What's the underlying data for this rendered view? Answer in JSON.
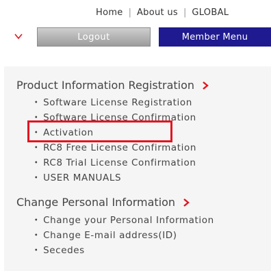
{
  "top_nav": {
    "home": "Home",
    "about": "About us",
    "global": "GLOBAL"
  },
  "buttons": {
    "logout": "Logout",
    "member_menu": "Member Menu"
  },
  "sections": {
    "product": {
      "title": "Product Information Registration",
      "links": [
        "Software License Registration",
        "Software License Confirmation",
        "Activation",
        "RC8 Free License Confirmation",
        "RC8 Trial License Confirmation",
        "USER MANUALS"
      ]
    },
    "personal": {
      "title": "Change Personal Information",
      "links": [
        "Change your Personal Information",
        "Change E-mail address(ID)",
        "Secedes"
      ]
    }
  },
  "bullet": "・",
  "colors": {
    "accent_red": "#e3141f",
    "member_button": "#1f1a8f",
    "logout_button": "#b0b0b0",
    "panel_bg": "#f5f5f5"
  }
}
